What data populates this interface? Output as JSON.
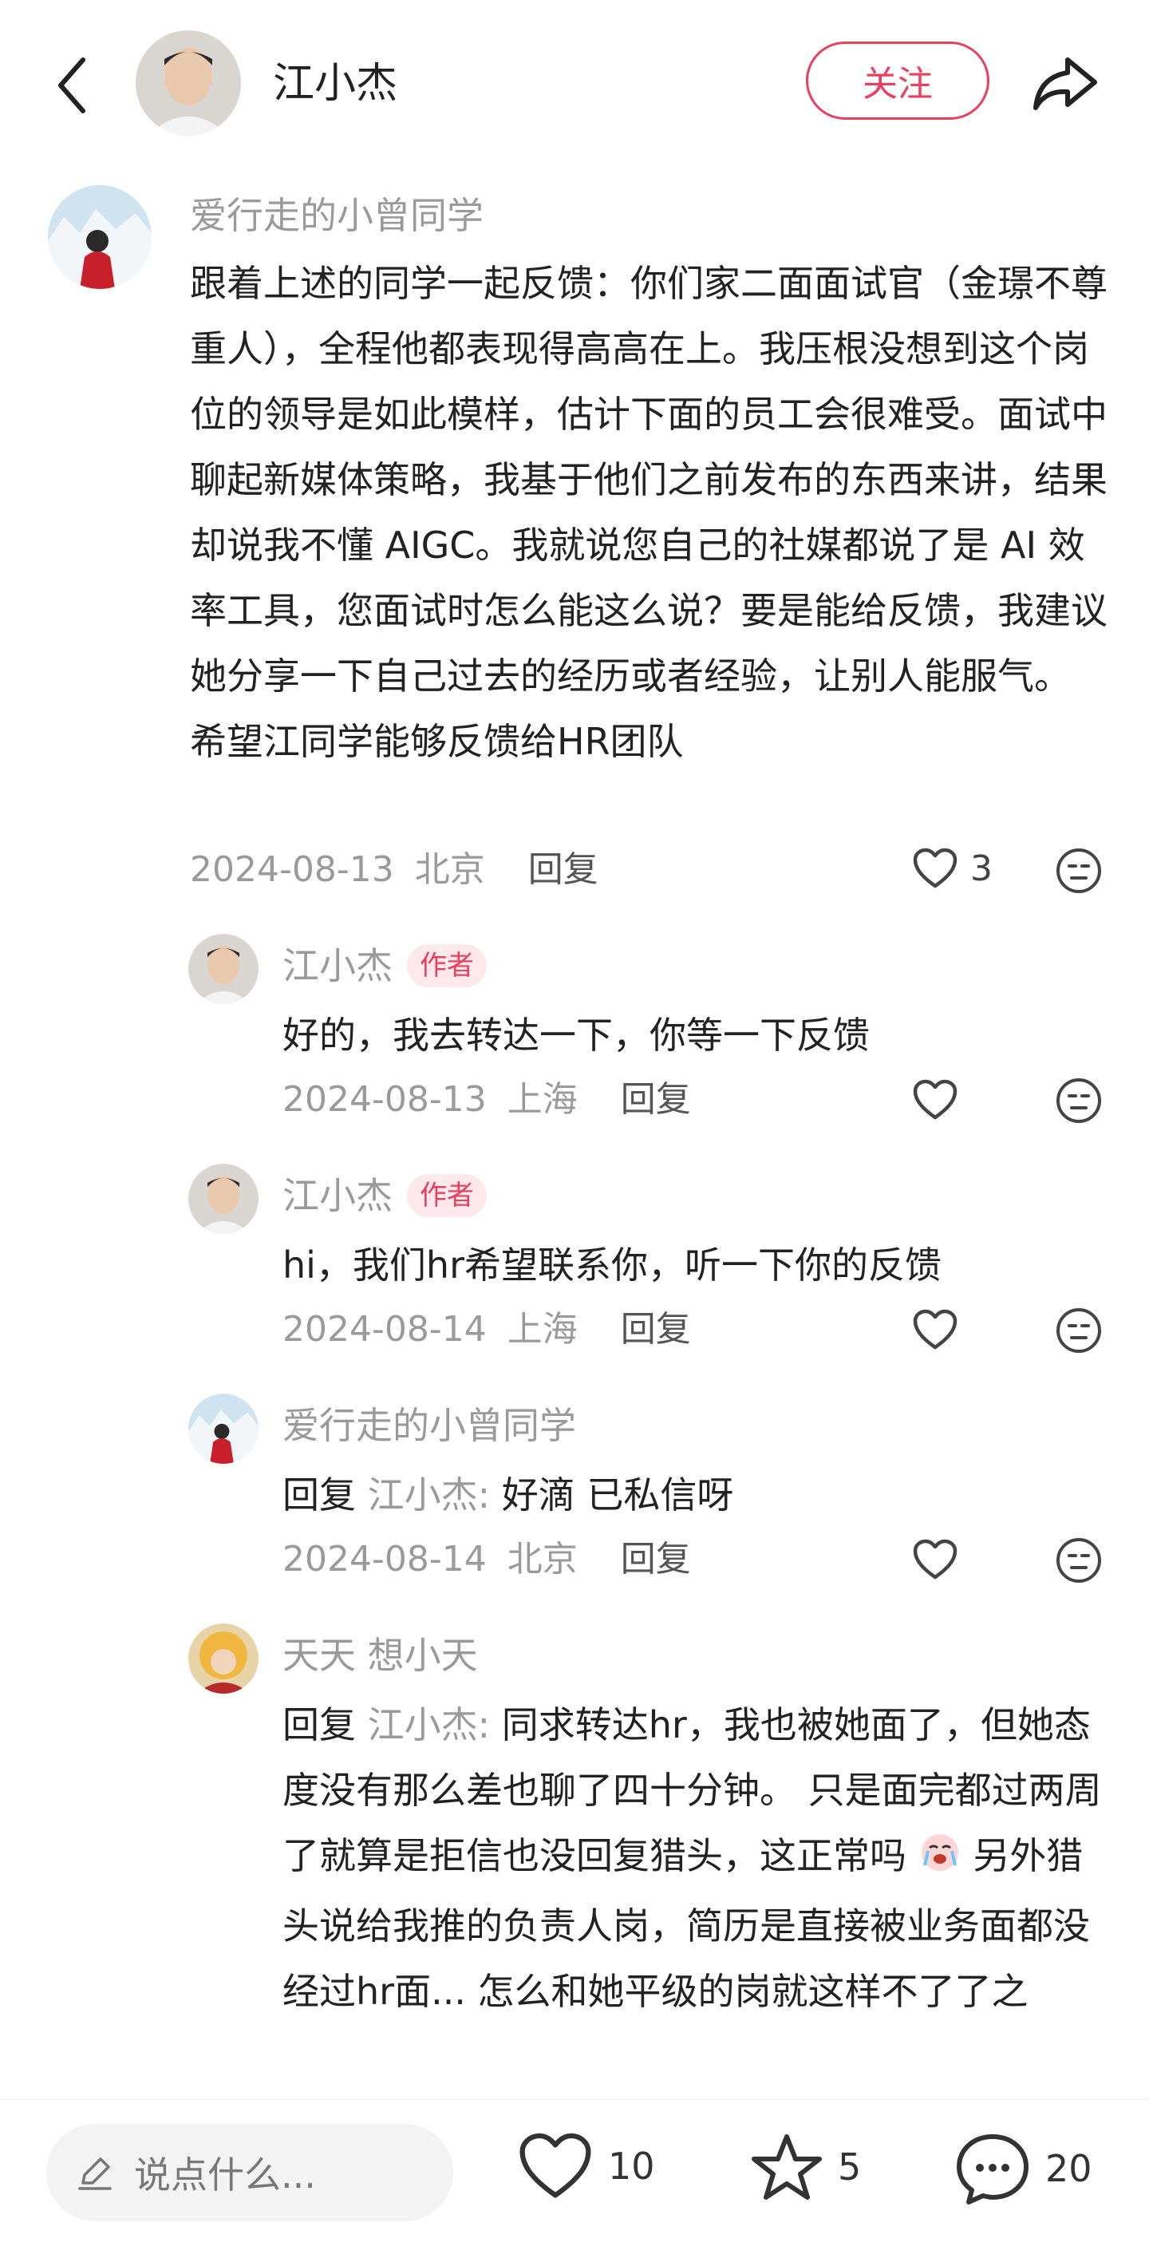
{
  "header": {
    "title": "江小杰",
    "follow_label": "关注",
    "icons": {
      "back": "back-arrow-icon",
      "share": "share-icon"
    }
  },
  "comments": [
    {
      "author": "爱行走的小曾同学",
      "text": "跟着上述的同学一起反馈：你们家二面面试官（金璟不尊重人），全程他都表现得高高在上。我压根没想到这个岗位的领导是如此模样，估计下面的员工会很难受。面试中聊起新媒体策略，我基于他们之前发布的东西来讲，结果却说我不懂 AIGC。我就说您自己的社媒都说了是 AI 效率工具，您面试时怎么能这么说？要是能给反馈，我建议她分享一下自己过去的经历或者经验，让别人能服气。 希望江同学能够反馈给HR团队",
      "date": "2024-08-13",
      "location": "北京",
      "reply_label": "回复",
      "likes": "3"
    }
  ],
  "replies": [
    {
      "author": "江小杰",
      "badge": "作者",
      "text": "好的，我去转达一下，你等一下反馈",
      "date": "2024-08-13",
      "location": "上海",
      "reply_label": "回复"
    },
    {
      "author": "江小杰",
      "badge": "作者",
      "text": "hi，我们hr希望联系你，听一下你的反馈",
      "date": "2024-08-14",
      "location": "上海",
      "reply_label": "回复"
    },
    {
      "author": "爱行走的小曾同学",
      "reply_prefix": "回复",
      "reply_to": "江小杰:",
      "text": "好滴 已私信呀",
      "date": "2024-08-14",
      "location": "北京",
      "reply_label": "回复"
    },
    {
      "author": "天天 想小天",
      "reply_prefix": "回复",
      "reply_to": "江小杰:",
      "text_part1": "同求转达hr，我也被她面了，但她态度没有那么差也聊了四十分钟。 只是面完都过两周了就算是拒信也没回复猎头，这正常吗",
      "text_part2": " 另外猎头说给我推的负责人岗，简历是直接被业务面都没经过hr面... 怎么和她平级的岗就这样不了了之"
    }
  ],
  "bottom_bar": {
    "input_placeholder": "说点什么...",
    "likes": "10",
    "stars": "5",
    "comments": "20"
  },
  "colors": {
    "accent": "#e8405e",
    "muted": "#9a9a9a",
    "text": "#222222"
  }
}
